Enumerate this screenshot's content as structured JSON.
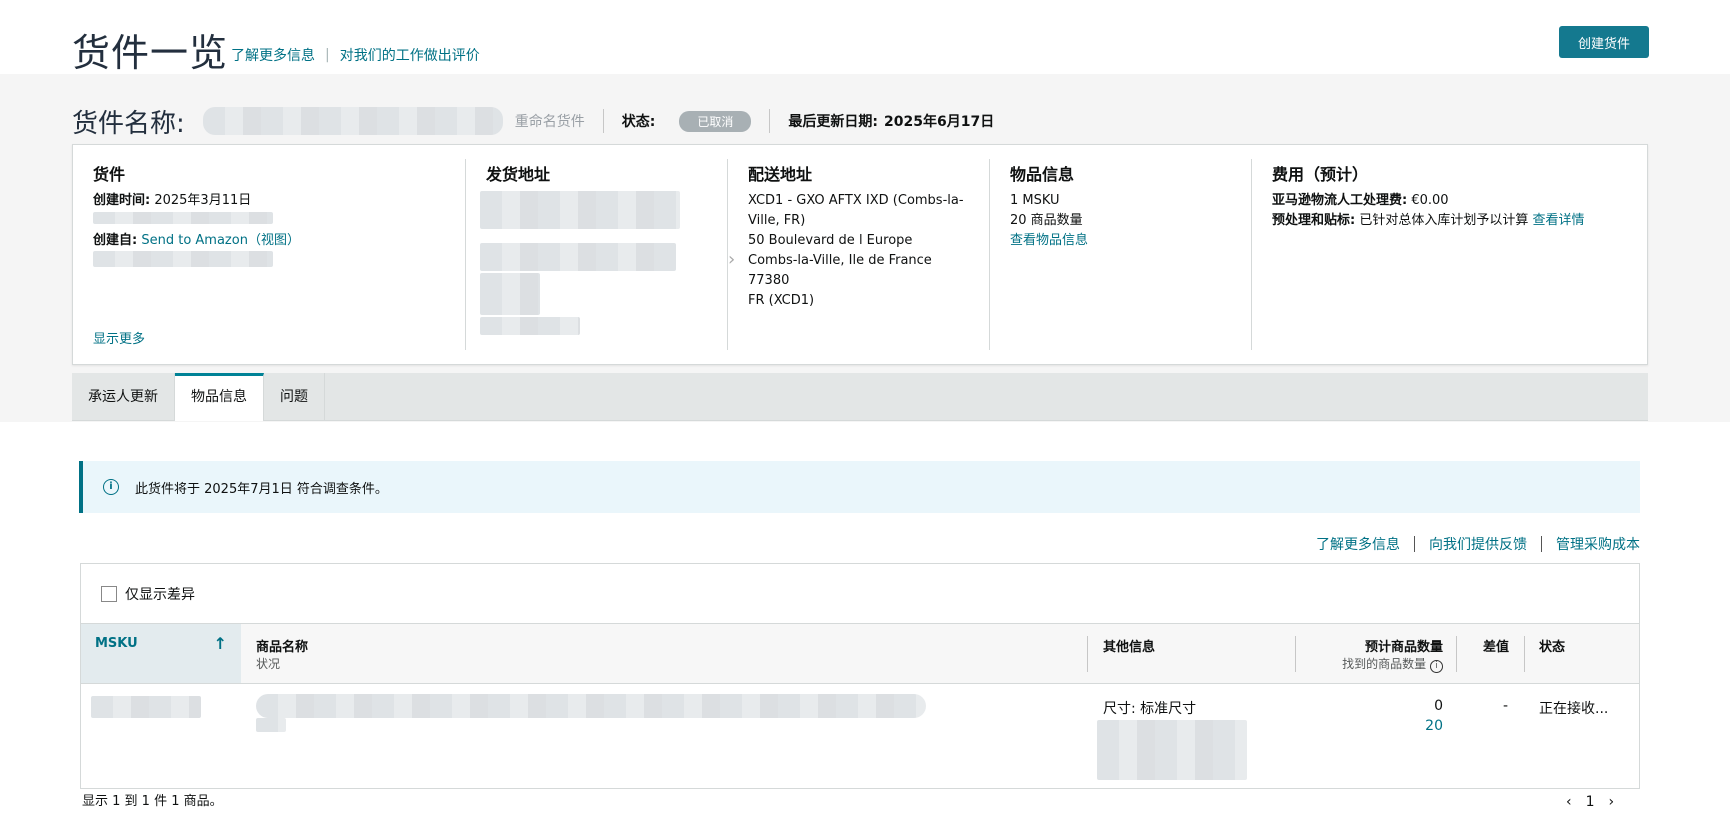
{
  "header": {
    "title": "货件一览",
    "learn_more": "了解更多信息",
    "separator": "|",
    "feedback": "对我们的工作做出评价",
    "create_button": "创建货件"
  },
  "shipment": {
    "name_label": "货件名称:",
    "rename": "重命名货件",
    "status_label": "状态:",
    "status_value": "已取消",
    "updated_label": "最后更新日期:",
    "updated_value": "2025年6月17日"
  },
  "card": {
    "shipment": {
      "title": "货件",
      "created_label": "创建时间:",
      "created_value": "2025年3月11日",
      "created_by_label": "创建自:",
      "created_by_value": "Send to Amazon（视图）",
      "show_more": "显示更多"
    },
    "ship_from": {
      "title": "发货地址"
    },
    "ship_to": {
      "title": "配送地址",
      "lines": [
        "XCD1 - GXO AFTX IXD (Combs-la-",
        "Ville, FR)",
        "50 Boulevard de l Europe",
        "Combs-la-Ville, Ile de France",
        "77380",
        "FR (XCD1)"
      ]
    },
    "items": {
      "title": "物品信息",
      "msku": "1 MSKU",
      "qty": "20 商品数量",
      "link": "查看物品信息"
    },
    "fees": {
      "title": "费用（预计）",
      "manual_label": "亚马逊物流人工处理费:",
      "manual_value": "€0.00",
      "prep_label": "预处理和贴标:",
      "prep_value": "已针对总体入库计划予以计算",
      "prep_link": "查看详情"
    }
  },
  "tabs": [
    "承运人更新",
    "物品信息",
    "问题"
  ],
  "alert": {
    "text": "此货件将于 2025年7月1日 符合调查条件。"
  },
  "sublinks": [
    "了解更多信息",
    "向我们提供反馈",
    "管理采购成本"
  ],
  "table": {
    "filter_label": "仅显示差异",
    "headers": {
      "msku": "MSKU",
      "name": "商品名称",
      "name_sub": "状况",
      "other": "其他信息",
      "qty": "预计商品数量",
      "qty_sub": "找到的商品数量",
      "diff": "差值",
      "status": "状态"
    },
    "rows": [
      {
        "size": "尺寸: 标准尺寸",
        "expected": "0",
        "found": "20",
        "diff": "-",
        "status": "正在接收..."
      }
    ]
  },
  "footer": {
    "summary": "显示 1 到 1 件 1 商品。",
    "page": "1",
    "prev": "‹",
    "next": "›"
  }
}
